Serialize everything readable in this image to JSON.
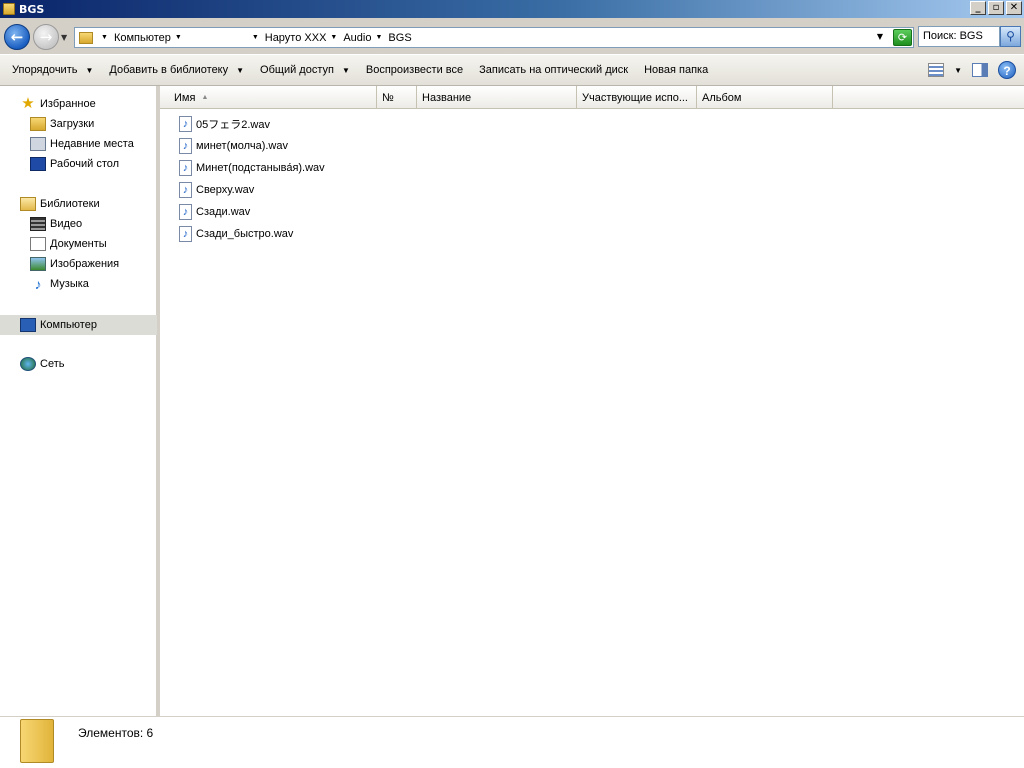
{
  "window": {
    "title": "BGS",
    "min": "_",
    "max": "▫",
    "close": "✕"
  },
  "nav": {
    "back": "←",
    "forward": "→",
    "history": "▼"
  },
  "address": {
    "crumbs": [
      "Компьютер",
      "Наруто XXX",
      "Audio",
      "BGS"
    ],
    "arrow": "▼",
    "refresh": "⟳"
  },
  "search": {
    "placeholder": "Поиск: BGS",
    "icon": "search-icon"
  },
  "commandbar": {
    "organize": "Упорядочить",
    "add_to_library": "Добавить в библиотеку",
    "share": "Общий доступ",
    "play_all": "Воспроизвести все",
    "burn": "Записать на оптический диск",
    "new_folder": "Новая папка",
    "dd": "▼",
    "help": "?"
  },
  "sidebar": {
    "favorites": "Избранное",
    "downloads": "Загрузки",
    "recent": "Недавние места",
    "desktop": "Рабочий стол",
    "libraries": "Библиотеки",
    "video": "Видео",
    "documents": "Документы",
    "pictures": "Изображения",
    "music": "Музыка",
    "computer": "Компьютер",
    "network": "Сеть",
    "star": "★",
    "note": "♪"
  },
  "columns": {
    "name": "Имя",
    "number": "№",
    "title": "Название",
    "artists": "Участвующие испо...",
    "album": "Альбом",
    "sort": "▲"
  },
  "files": [
    {
      "name": "05フェラ2.wav"
    },
    {
      "name": "минет(молча).wav"
    },
    {
      "name": "Минет(подстаныва́я).wav"
    },
    {
      "name": "Сверху.wav"
    },
    {
      "name": "Сзади.wav"
    },
    {
      "name": "Сзади_быстро.wav"
    }
  ],
  "file_icon": "♪",
  "status": {
    "items": "Элементов: 6"
  }
}
